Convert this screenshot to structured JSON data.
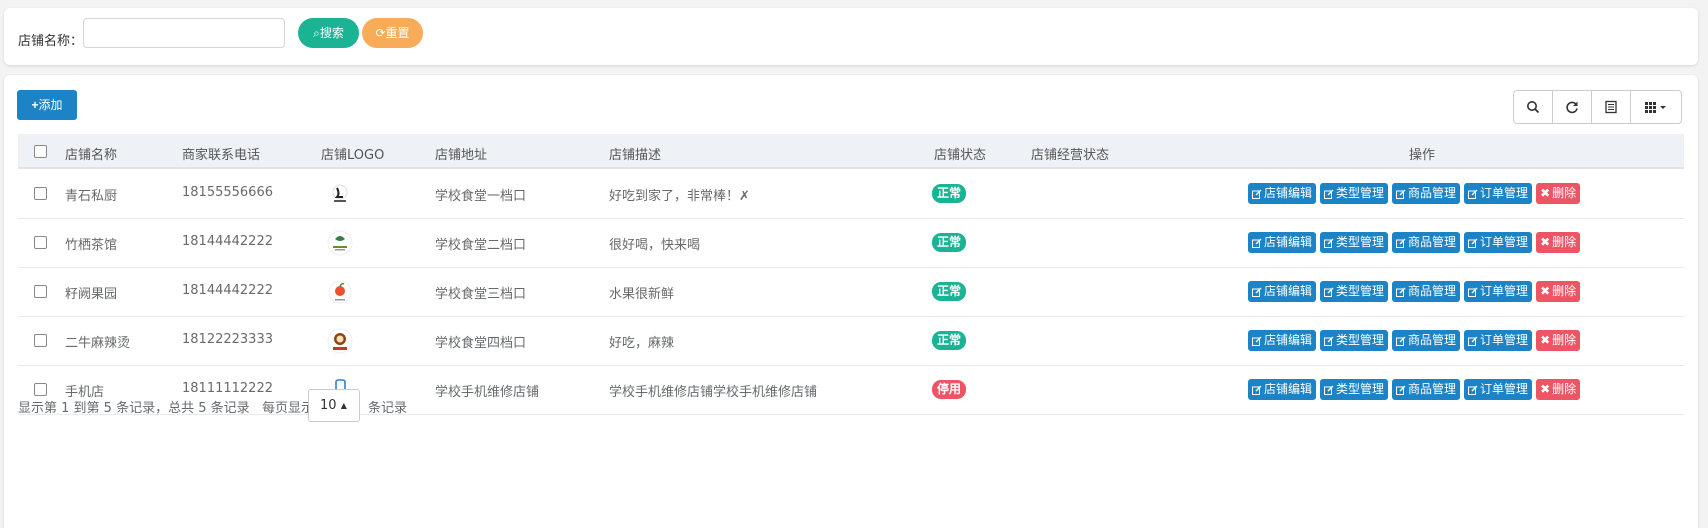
{
  "search": {
    "label": "店铺名称：",
    "input_value": "",
    "search_button": "搜索",
    "reset_button": "重置"
  },
  "toolbar": {
    "add_button": "添加",
    "tools": [
      "search-icon",
      "refresh-icon",
      "list-icon",
      "columns-icon"
    ]
  },
  "table": {
    "columns": [
      "店铺名称",
      "商家联系电话",
      "店铺LOGO",
      "店铺地址",
      "店铺描述",
      "店铺状态",
      "店铺经营状态",
      "操作"
    ],
    "rows": [
      {
        "name": "青石私厨",
        "phone": "18155556666",
        "logo": "logo-1",
        "address": "学校食堂一档口",
        "desc": "好吃到家了，非常棒！✗",
        "status": "正常",
        "status_color": "#1ab394",
        "biz_status": ""
      },
      {
        "name": "竹栖茶馆",
        "phone": "18144442222",
        "logo": "logo-2",
        "address": "学校食堂二档口",
        "desc": "很好喝，快来喝",
        "status": "正常",
        "status_color": "#1ab394",
        "biz_status": ""
      },
      {
        "name": "籽阙果园",
        "phone": "18144442222",
        "logo": "logo-3",
        "address": "学校食堂三档口",
        "desc": "水果很新鲜",
        "status": "正常",
        "status_color": "#1ab394",
        "biz_status": ""
      },
      {
        "name": "二牛麻辣烫",
        "phone": "18122223333",
        "logo": "logo-4",
        "address": "学校食堂四档口",
        "desc": "好吃，麻辣",
        "status": "正常",
        "status_color": "#1ab394",
        "biz_status": ""
      },
      {
        "name": "手机店",
        "phone": "18111112222",
        "logo": "logo-5",
        "address": "学校手机维修店铺",
        "desc": "学校手机维修店铺学校手机维修店铺",
        "status": "停用",
        "status_color": "#ed5565",
        "biz_status": ""
      }
    ],
    "actions": [
      "店铺编辑",
      "类型管理",
      "商品管理",
      "订单管理",
      "删除"
    ]
  },
  "pagination": {
    "summary": "显示第 1 到第 5 条记录，总共 5 条记录",
    "per_page_label": "每页显示",
    "per_page_value": "10",
    "suffix": "条记录"
  },
  "colors": {
    "primary": "#1c84c6",
    "success": "#1ab394",
    "warning": "#f8ac59",
    "danger": "#ed5565"
  }
}
